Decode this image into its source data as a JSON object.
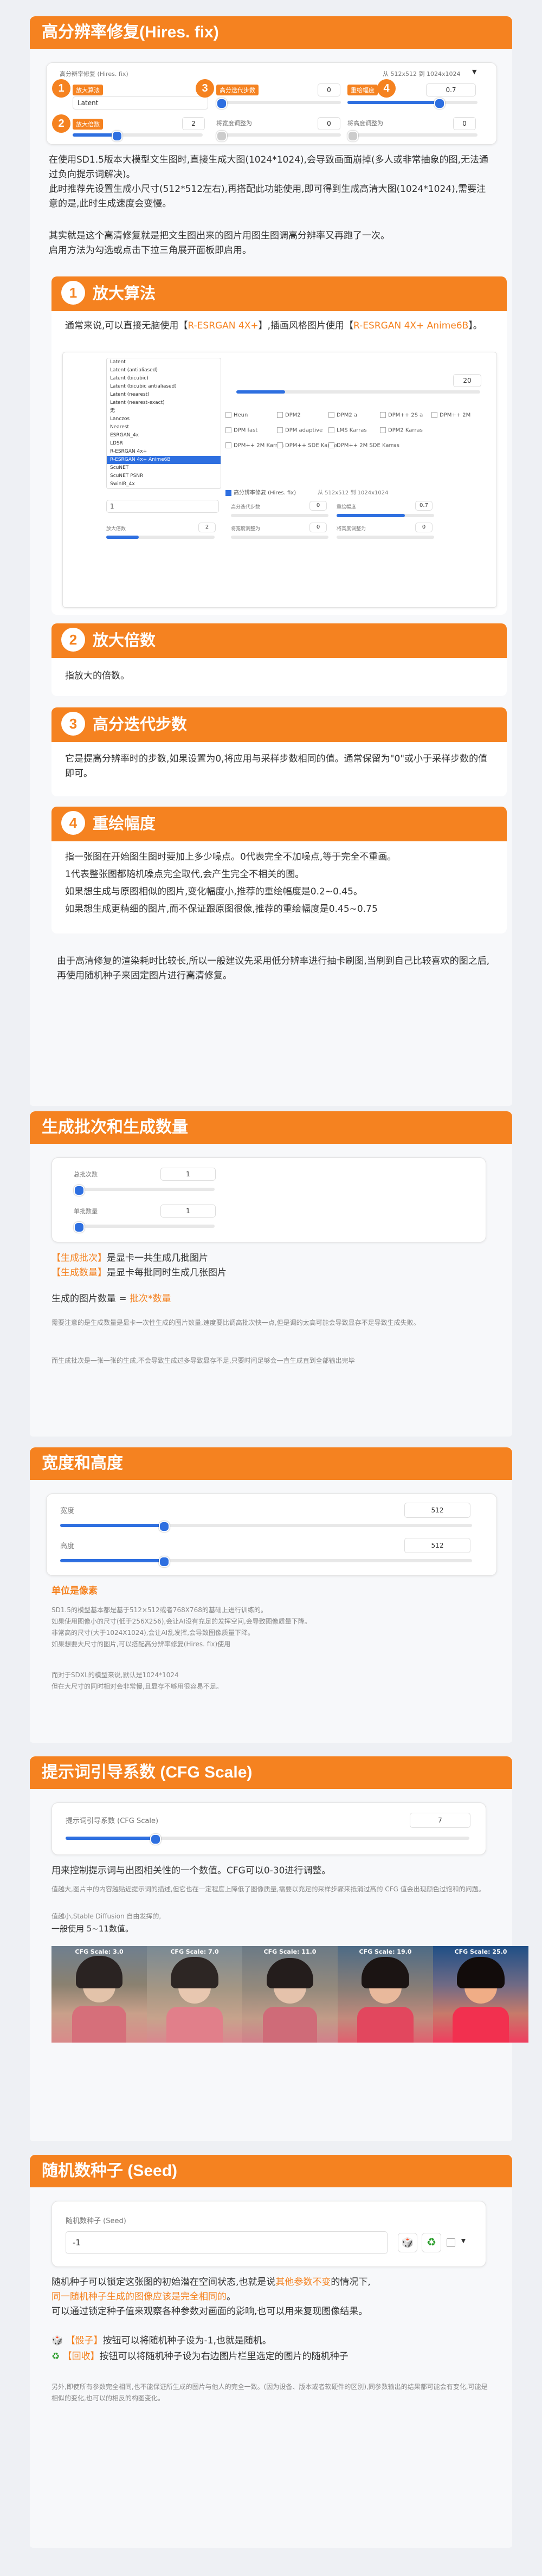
{
  "hires": {
    "title": "高分辨率修复(Hires. fix)",
    "panel": {
      "upscaler_label": "高分辨率修复 (Hires. fix)",
      "upscaler_tag": "放大算法",
      "upscaler_value": "Latent",
      "steps_tag": "高分迭代步数",
      "steps_value": "0",
      "denoise_tag": "重绘幅度",
      "denoise_value": "0.7",
      "info": "从 512x512 到 1024x1024",
      "scale_tag": "放大倍数",
      "scale_value": "2",
      "resize_w_label": "将宽度调整为",
      "resize_w_value": "0",
      "resize_h_label": "将高度调整为",
      "resize_h_value": "0",
      "badge1": "1",
      "badge2": "2",
      "badge3": "3",
      "badge4": "4",
      "dropdown_arrow": "▼"
    },
    "intro1": "在使用SD1.5版本大模型文生图时,直接生成大图(1024*1024),会导致画面崩掉(多人或非常抽象的图,无法通过负向提示词解决)。",
    "intro2": "此时推荐先设置生成小尺寸(512*512左右),再搭配此功能使用,即可得到生成高清大图(1024*1024),需要注意的是,此时生成速度会变慢。",
    "intro3": "其实就是这个高清修复就是把文生图出来的图片用图生图调高分辨率又再跑了一次。",
    "intro4": "启用方法为勾选或点击下拉三角展开面板即启用。",
    "subs": [
      {
        "num": "1",
        "title": "放大算法"
      },
      {
        "num": "2",
        "title": "放大倍数"
      },
      {
        "num": "3",
        "title": "高分迭代步数"
      },
      {
        "num": "4",
        "title": "重绘幅度"
      }
    ],
    "upscaler_text1": "通常来说,可以直接无脑使用【",
    "upscaler_hl1": "R-ESRGAN 4X+",
    "upscaler_text2": "】,插画风格图片使用【",
    "upscaler_hl2": "R-ESRGAN 4X+ Anime6B",
    "upscaler_text3": "】。",
    "dropdown_items": [
      "Latent",
      "Latent (antialiased)",
      "Latent (bicubic)",
      "Latent (bicubic antialiased)",
      "Latent (nearest)",
      "Latent (nearest-exact)",
      "无",
      "Lanczos",
      "Nearest",
      "ESRGAN_4x",
      "LDSR",
      "R-ESRGAN 4x+",
      "R-ESRGAN 4x+ Anime6B",
      "ScuNET",
      "ScuNET PSNR",
      "SwinIR_4x"
    ],
    "dropdown_selected": "R-ESRGAN 4x+ Anime6B",
    "dropdown_value": "1",
    "mock_value_20": "20",
    "mock_samplers": [
      "Heun",
      "DPM2",
      "DPM2 a",
      "DPM++ 2S a",
      "DPM++ 2M",
      "DPM fast",
      "DPM adaptive",
      "LMS Karras",
      "DPM2 Karras",
      "DPM++ 2M Karras",
      "DPM++ SDE Karras",
      "DPM++ 2M SDE Karras"
    ],
    "mock_hires_check": "高分辨率修复 (Hires. fix)",
    "mock_info": "从 512x512 到 1024x1024",
    "mock_steps_label": "高分迭代步数",
    "mock_steps_value": "0",
    "mock_denoise_label": "重绘幅度",
    "mock_denoise_value": "0.7",
    "mock_scale_label": "放大倍数",
    "mock_scale_value": "2",
    "mock_w_label": "将宽度调整为",
    "mock_w_value": "0",
    "mock_h_label": "将高度调整为",
    "mock_h_value": "0",
    "scale_desc": "指放大的倍数。",
    "steps_desc": "它是提高分辨率时的步数,如果设置为0,将应用与采样步数相同的值。通常保留为\"0\"或小于采样步数的值即可。",
    "denoise_desc": [
      "指一张图在开始图生图时要加上多少噪点。0代表完全不加噪点,等于完全不重画。",
      "1代表整张图都随机噪点完全取代,会产生完全不相关的图。",
      "如果想生成与原图相似的图片,变化幅度小,推荐的重绘幅度是0.2~0.45。",
      "如果想生成更精细的图片,而不保证跟原图很像,推荐的重绘幅度是0.45~0.75"
    ],
    "outro": "由于高清修复的渲染耗时比较长,所以一般建议先采用低分辨率进行抽卡刷图,当刷到自己比较喜欢的图之后,再使用随机种子来固定图片进行高清修复。"
  },
  "batch": {
    "title": "生成批次和生成数量",
    "count_label": "总批次数",
    "count_value": "1",
    "size_label": "单批数量",
    "size_value": "1",
    "line1_hl": "【生成批次】",
    "line1": "是显卡一共生成几批图片",
    "line2_hl": "【生成数量】",
    "line2": "是显卡每批同时生成几张图片",
    "formula_pre": "生成的图片数量 = ",
    "formula_hl": "批次*数量",
    "note1": "需要注意的是生成数量是显卡一次性生成的图片数量,速度要比调高批次快一点,但是调的太高可能会导致显存不足导致生成失败。",
    "note2": "而生成批次是一张一张的生成,不会导致生成过多导致显存不足,只要时间足够会一直生成直到全部输出完毕"
  },
  "size": {
    "title": "宽度和高度",
    "width_label": "宽度",
    "width_value": "512",
    "height_label": "高度",
    "height_value": "512",
    "width_fraction": 0.25,
    "height_fraction": 0.25,
    "unit": "单位是像素",
    "notes": [
      "SD1.5的模型基本都是基于512×512或者768X768的基础上进行训练的。",
      "如果使用图像小的尺寸(低于256X256),会让AI没有充足的发挥空间,会导致图像质量下降。",
      "非常高的尺寸(大于1024X1024),会让AI乱发挥,会导致图像质量下降。",
      "如果想要大尺寸的图片,可以搭配高分辨率修复(Hires. fix)使用"
    ],
    "notes2": [
      "而对于SDXL的模型来说,默认是1024*1024",
      "但在大尺寸的同时相对会非常慢,且显存不够用很容易不足。"
    ]
  },
  "cfg": {
    "title": "提示词引导系数 (CFG Scale)",
    "label": "提示词引导系数 (CFG Scale)",
    "value": "7",
    "fraction": 0.22,
    "desc": "用来控制提示词与出图相关性的一个数值。CFG可以0-30进行调整。",
    "note1": "值越大,图片中的内容越贴近提示词的描述,但它也在一定程度上降低了图像质量,需要以充足的采样步骤来抵消过高的 CFG 值会出现颜色过饱和的问题。",
    "note2": "值越小,Stable Diffusion 自由发挥的,",
    "note3": "一般使用 5~11数值。",
    "photos": [
      "CFG Scale: 3.0",
      "CFG Scale: 7.0",
      "CFG Scale: 11.0",
      "CFG Scale: 19.0",
      "CFG Scale: 25.0"
    ]
  },
  "seed": {
    "title": "随机数种子 (Seed)",
    "label": "随机数种子 (Seed)",
    "value": "-1",
    "dice_icon": "🎲",
    "recycle_icon": "♻",
    "dropdown_arrow": "▼",
    "desc1_pre": "随机种子可以锁定这张图的初始潜在空间状态,也就是说",
    "desc1_hl": "其他参数不变",
    "desc1_post": "的情况下,",
    "desc2_hl": "同一随机种子生成的图像应该是完全相同的",
    "desc2_post": "。",
    "desc3": "可以通过锁定种子值来观察各种参数对画面的影响,也可以用来复现图像结果。",
    "dice_hl": "【骰子】",
    "dice_text": "按钮可以将随机种子设为-1,也就是随机。",
    "recycle_hl": "【回收】",
    "recycle_text": "按钮可以将随机种子设为右边图片栏里选定的图片的随机种子",
    "note": "另外,即使所有参数完全相同,也不能保证所生成的图片与他人的完全一致。(因为设备、版本或者软硬件的区别),同参数输出的结果都可能会有变化,可能是相似的变化,也可以的相反的构图变化。"
  }
}
